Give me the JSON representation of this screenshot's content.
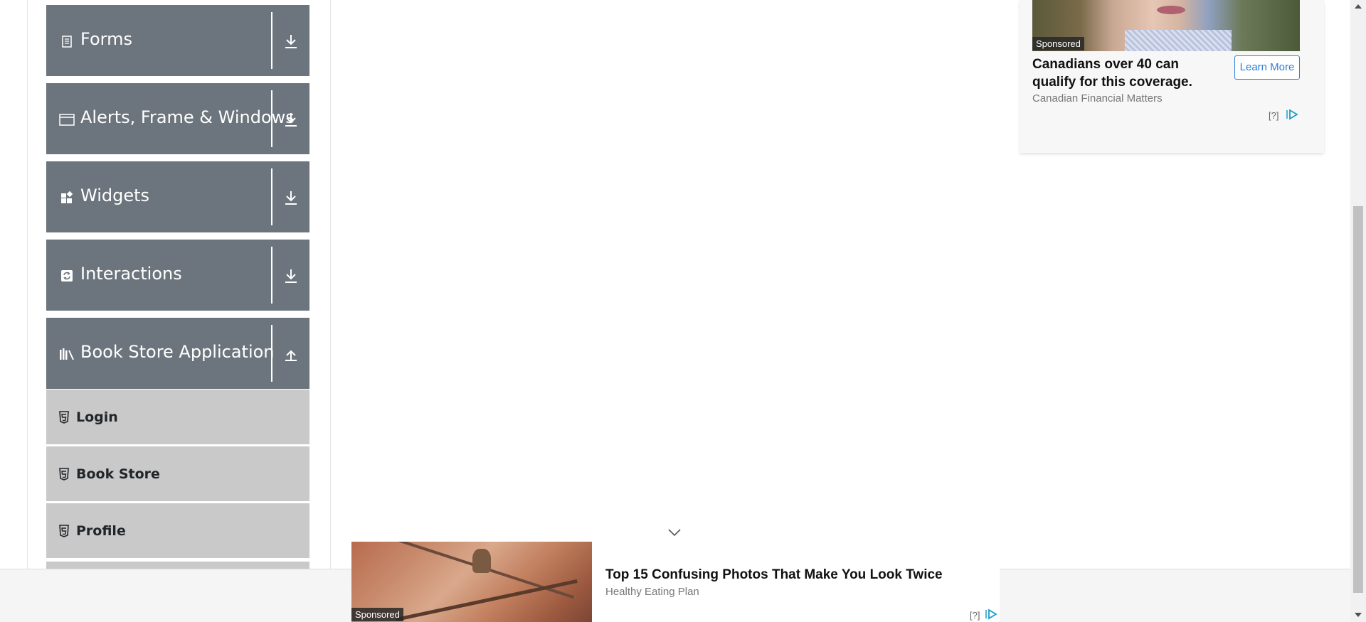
{
  "sidebar": {
    "groups": [
      {
        "label": "Forms",
        "icon": "forms-icon",
        "arrow": "download-arrow-icon"
      },
      {
        "label": "Alerts, Frame & Windows",
        "icon": "window-icon",
        "arrow": "download-arrow-icon"
      },
      {
        "label": "Widgets",
        "icon": "widgets-icon",
        "arrow": "download-arrow-icon"
      },
      {
        "label": "Interactions",
        "icon": "interactions-icon",
        "arrow": "download-arrow-icon"
      },
      {
        "label": "Book Store Application",
        "icon": "books-icon",
        "arrow": "upload-arrow-icon"
      }
    ],
    "book_store_items": [
      {
        "label": "Login",
        "icon": "html5-icon"
      },
      {
        "label": "Book Store",
        "icon": "html5-icon"
      },
      {
        "label": "Profile",
        "icon": "html5-icon"
      }
    ]
  },
  "ad_right": {
    "sponsored": "Sponsored",
    "headline": "Canadians over 40 can qualify for this coverage.",
    "source": "Canadian Financial Matters",
    "cta": "Learn More",
    "info": "[?]"
  },
  "ad_bottom": {
    "sponsored": "Sponsored",
    "headline": "Top 15 Confusing Photos That Make You Look Twice",
    "source": "Healthy Eating Plan",
    "info": "[?]"
  },
  "colors": {
    "group_bg": "#6c757d",
    "item_bg": "#c9c9c9",
    "cta_blue": "#2f7fd6"
  }
}
